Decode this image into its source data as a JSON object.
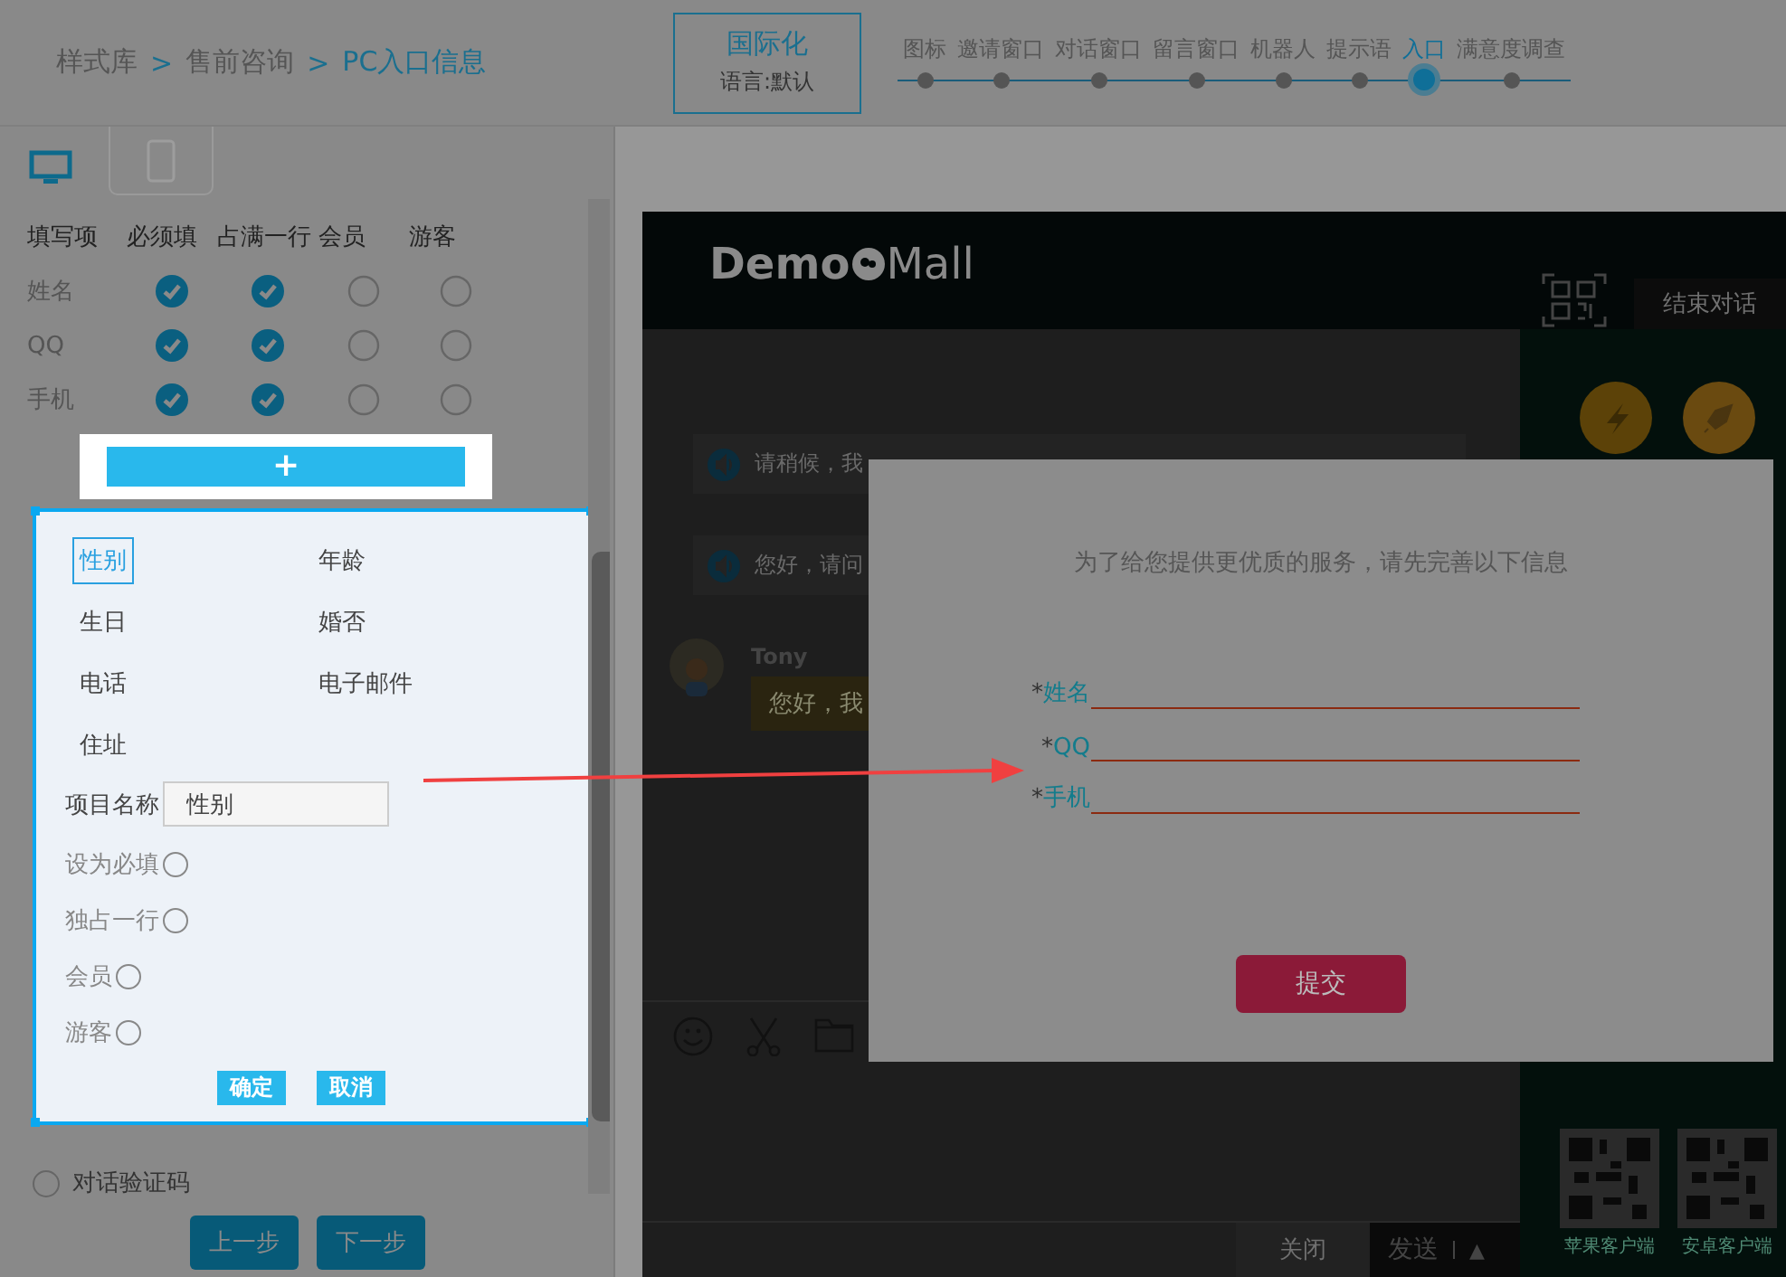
{
  "header": {
    "breadcrumb": [
      {
        "label": "样式库",
        "current": false
      },
      {
        "label": "售前咨询",
        "current": false
      },
      {
        "label": "PC入口信息",
        "current": true
      }
    ],
    "separator": ">",
    "language_box": {
      "title": "国际化",
      "subtitle": "语言:默认"
    },
    "steps": [
      {
        "label": "图标",
        "selected": false
      },
      {
        "label": "邀请窗口",
        "selected": false
      },
      {
        "label": "对话窗口",
        "selected": false
      },
      {
        "label": "留言窗口",
        "selected": false
      },
      {
        "label": "机器人",
        "selected": false
      },
      {
        "label": "提示语",
        "selected": false
      },
      {
        "label": "入口",
        "selected": true
      },
      {
        "label": "满意度调查",
        "selected": false
      }
    ]
  },
  "device_tabs": [
    {
      "kind": "desktop",
      "selected": true
    },
    {
      "kind": "mobile",
      "selected": false
    }
  ],
  "fields_table": {
    "columns": [
      "填写项",
      "必须填",
      "占满一行",
      "会员",
      "游客"
    ],
    "rows": [
      {
        "name": "姓名",
        "required": true,
        "full_row": true,
        "member": false,
        "guest": false
      },
      {
        "name": "QQ",
        "required": true,
        "full_row": true,
        "member": false,
        "guest": false
      },
      {
        "name": "手机",
        "required": true,
        "full_row": true,
        "member": false,
        "guest": false
      }
    ]
  },
  "add_button": "+",
  "popup": {
    "options": [
      {
        "label": "性别",
        "selected": true
      },
      {
        "label": "年龄",
        "selected": false
      },
      {
        "label": "生日",
        "selected": false
      },
      {
        "label": "婚否",
        "selected": false
      },
      {
        "label": "电话",
        "selected": false
      },
      {
        "label": "电子邮件",
        "selected": false
      },
      {
        "label": "住址",
        "selected": false
      }
    ],
    "name_label": "项目名称",
    "name_value": "性别",
    "toggles": [
      {
        "label": "设为必填",
        "checked": false
      },
      {
        "label": "独占一行",
        "checked": false
      },
      {
        "label": "会员",
        "checked": false
      },
      {
        "label": "游客",
        "checked": false
      }
    ],
    "buttons": [
      "确定",
      "取消"
    ]
  },
  "captcha": {
    "label": "对话验证码",
    "checked": false
  },
  "nav_buttons": [
    "上一步",
    "下一步"
  ],
  "preview": {
    "logo_bold": "Demo",
    "logo_light": "Mall",
    "end_chat": "结束对话",
    "messages": [
      "请稍候，我",
      "您好，请问"
    ],
    "agent": {
      "name": "Tony",
      "text": "您好，我"
    },
    "close": "关闭",
    "send": "发送",
    "send_caret": "▲",
    "qr_labels": [
      "苹果客户端",
      "安卓客户端"
    ],
    "dialog": {
      "intro": "为了给您提供更优质的服务，请先完善以下信息",
      "fields": [
        {
          "mark": "*",
          "label": "姓名"
        },
        {
          "mark": "*",
          "label": "QQ"
        },
        {
          "mark": "*",
          "label": "手机"
        }
      ],
      "submit": "提交"
    }
  }
}
